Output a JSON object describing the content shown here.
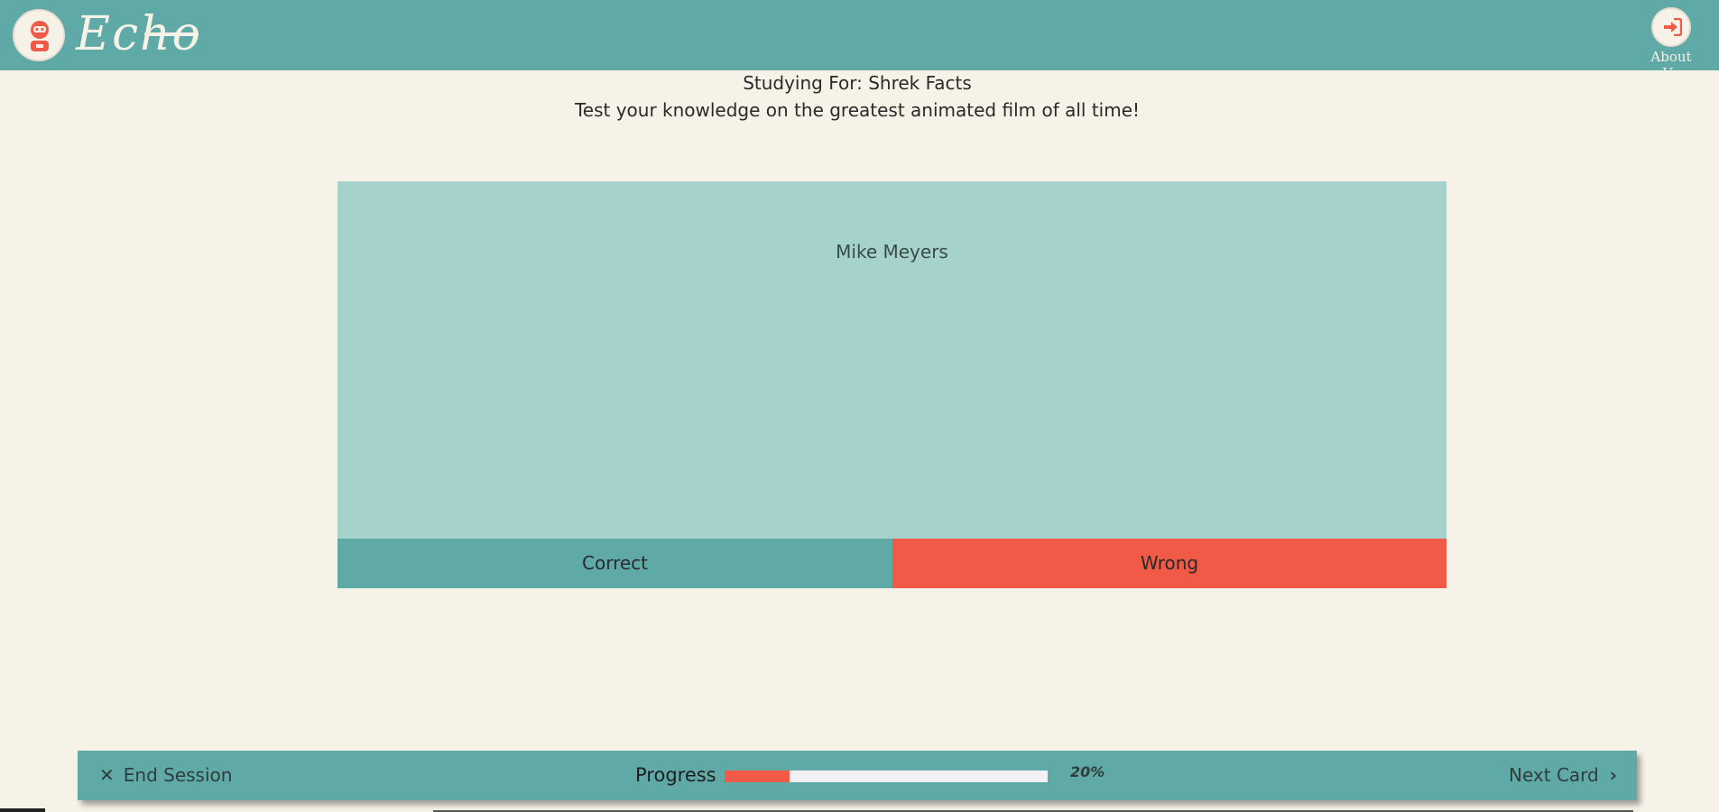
{
  "header": {
    "brand": "Echo",
    "about_label": "About Us"
  },
  "study": {
    "title": "Studying For: Shrek Facts",
    "subtitle": "Test your knowledge on the greatest animated film of all time!"
  },
  "card": {
    "text": "Mike Meyers",
    "correct_label": "Correct",
    "wrong_label": "Wrong"
  },
  "footer": {
    "end_session_label": "End Session",
    "progress_label": "Progress",
    "progress_value": 0.2,
    "progress_text": "20%",
    "next_card_label": "Next Card"
  },
  "colors": {
    "teal": "#5fa9a7",
    "light_teal": "#a5d3cc",
    "coral": "#f05a47",
    "cream": "#f7f2e7"
  },
  "icons": {
    "logo": "robot-avatar-icon",
    "about": "sign-in-icon",
    "end_session": "close-icon",
    "next_card": "chevron-right-icon"
  }
}
